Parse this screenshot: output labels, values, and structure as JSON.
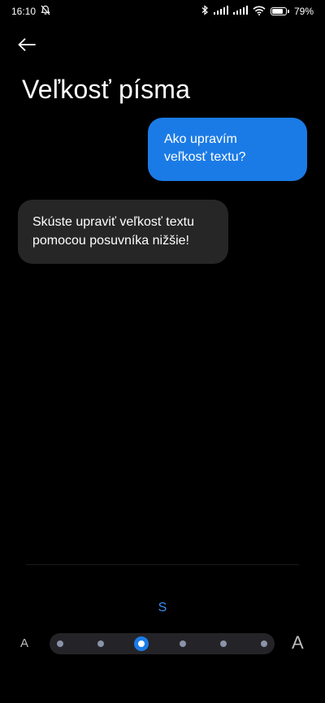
{
  "status_bar": {
    "time": "16:10",
    "battery_percent": "79%",
    "battery_level": 0.79,
    "icons": [
      "notifications-off-icon",
      "bluetooth-icon",
      "signal-icon",
      "signal-icon",
      "wifi-icon",
      "battery-icon"
    ]
  },
  "header": {
    "back_icon": "arrow-left-icon",
    "title": "Veľkosť písma"
  },
  "chat": {
    "user_message": "Ako upravím\nveľkosť textu?",
    "reply_message": "Skúste upraviť veľkosť textu\npomocou posuvníka nižšie!"
  },
  "font_size": {
    "current_label": "S",
    "small_label": "A",
    "large_label": "A",
    "steps": 6,
    "selected_step": 3
  },
  "colors": {
    "background": "#000000",
    "accent": "#1b7be6",
    "reply_bubble": "#262626",
    "slider_track": "#242428"
  }
}
